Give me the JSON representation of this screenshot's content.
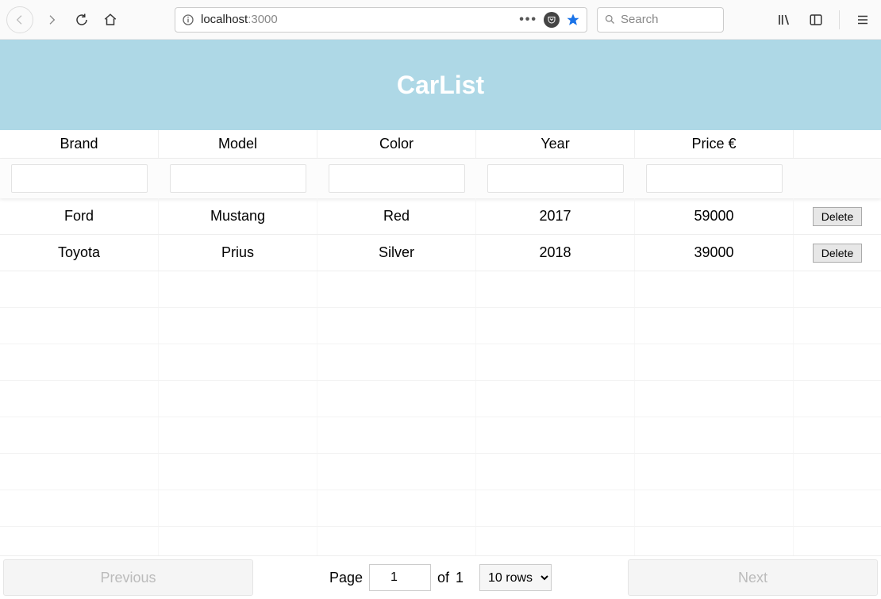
{
  "browser": {
    "url_host": "localhost",
    "url_port": ":3000",
    "search_placeholder": "Search"
  },
  "app": {
    "title": "CarList"
  },
  "table": {
    "columns": [
      "Brand",
      "Model",
      "Color",
      "Year",
      "Price €"
    ],
    "action_label": "Delete",
    "rows": [
      {
        "brand": "Ford",
        "model": "Mustang",
        "color": "Red",
        "year": "2017",
        "price": "59000"
      },
      {
        "brand": "Toyota",
        "model": "Prius",
        "color": "Silver",
        "year": "2018",
        "price": "39000"
      }
    ]
  },
  "pagination": {
    "previous": "Previous",
    "next": "Next",
    "page_label": "Page",
    "of_label": "of",
    "current_page": "1",
    "total_pages": "1",
    "rows_select": "10 rows"
  }
}
